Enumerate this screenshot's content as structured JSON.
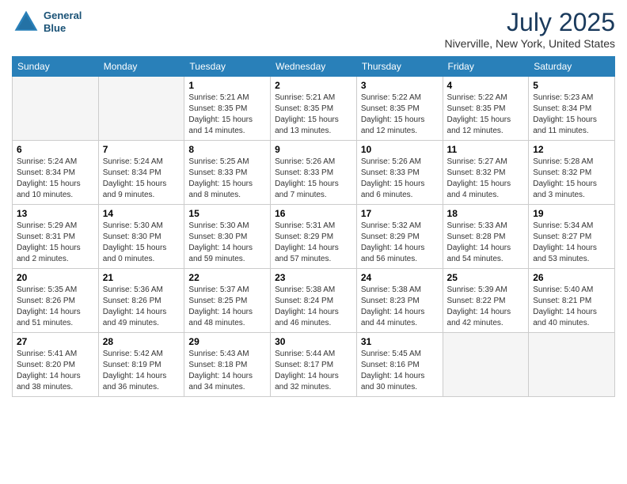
{
  "header": {
    "logo_line1": "General",
    "logo_line2": "Blue",
    "title": "July 2025",
    "location": "Niverville, New York, United States"
  },
  "days_of_week": [
    "Sunday",
    "Monday",
    "Tuesday",
    "Wednesday",
    "Thursday",
    "Friday",
    "Saturday"
  ],
  "weeks": [
    [
      {
        "num": "",
        "info": ""
      },
      {
        "num": "",
        "info": ""
      },
      {
        "num": "1",
        "info": "Sunrise: 5:21 AM\nSunset: 8:35 PM\nDaylight: 15 hours\nand 14 minutes."
      },
      {
        "num": "2",
        "info": "Sunrise: 5:21 AM\nSunset: 8:35 PM\nDaylight: 15 hours\nand 13 minutes."
      },
      {
        "num": "3",
        "info": "Sunrise: 5:22 AM\nSunset: 8:35 PM\nDaylight: 15 hours\nand 12 minutes."
      },
      {
        "num": "4",
        "info": "Sunrise: 5:22 AM\nSunset: 8:35 PM\nDaylight: 15 hours\nand 12 minutes."
      },
      {
        "num": "5",
        "info": "Sunrise: 5:23 AM\nSunset: 8:34 PM\nDaylight: 15 hours\nand 11 minutes."
      }
    ],
    [
      {
        "num": "6",
        "info": "Sunrise: 5:24 AM\nSunset: 8:34 PM\nDaylight: 15 hours\nand 10 minutes."
      },
      {
        "num": "7",
        "info": "Sunrise: 5:24 AM\nSunset: 8:34 PM\nDaylight: 15 hours\nand 9 minutes."
      },
      {
        "num": "8",
        "info": "Sunrise: 5:25 AM\nSunset: 8:33 PM\nDaylight: 15 hours\nand 8 minutes."
      },
      {
        "num": "9",
        "info": "Sunrise: 5:26 AM\nSunset: 8:33 PM\nDaylight: 15 hours\nand 7 minutes."
      },
      {
        "num": "10",
        "info": "Sunrise: 5:26 AM\nSunset: 8:33 PM\nDaylight: 15 hours\nand 6 minutes."
      },
      {
        "num": "11",
        "info": "Sunrise: 5:27 AM\nSunset: 8:32 PM\nDaylight: 15 hours\nand 4 minutes."
      },
      {
        "num": "12",
        "info": "Sunrise: 5:28 AM\nSunset: 8:32 PM\nDaylight: 15 hours\nand 3 minutes."
      }
    ],
    [
      {
        "num": "13",
        "info": "Sunrise: 5:29 AM\nSunset: 8:31 PM\nDaylight: 15 hours\nand 2 minutes."
      },
      {
        "num": "14",
        "info": "Sunrise: 5:30 AM\nSunset: 8:30 PM\nDaylight: 15 hours\nand 0 minutes."
      },
      {
        "num": "15",
        "info": "Sunrise: 5:30 AM\nSunset: 8:30 PM\nDaylight: 14 hours\nand 59 minutes."
      },
      {
        "num": "16",
        "info": "Sunrise: 5:31 AM\nSunset: 8:29 PM\nDaylight: 14 hours\nand 57 minutes."
      },
      {
        "num": "17",
        "info": "Sunrise: 5:32 AM\nSunset: 8:29 PM\nDaylight: 14 hours\nand 56 minutes."
      },
      {
        "num": "18",
        "info": "Sunrise: 5:33 AM\nSunset: 8:28 PM\nDaylight: 14 hours\nand 54 minutes."
      },
      {
        "num": "19",
        "info": "Sunrise: 5:34 AM\nSunset: 8:27 PM\nDaylight: 14 hours\nand 53 minutes."
      }
    ],
    [
      {
        "num": "20",
        "info": "Sunrise: 5:35 AM\nSunset: 8:26 PM\nDaylight: 14 hours\nand 51 minutes."
      },
      {
        "num": "21",
        "info": "Sunrise: 5:36 AM\nSunset: 8:26 PM\nDaylight: 14 hours\nand 49 minutes."
      },
      {
        "num": "22",
        "info": "Sunrise: 5:37 AM\nSunset: 8:25 PM\nDaylight: 14 hours\nand 48 minutes."
      },
      {
        "num": "23",
        "info": "Sunrise: 5:38 AM\nSunset: 8:24 PM\nDaylight: 14 hours\nand 46 minutes."
      },
      {
        "num": "24",
        "info": "Sunrise: 5:38 AM\nSunset: 8:23 PM\nDaylight: 14 hours\nand 44 minutes."
      },
      {
        "num": "25",
        "info": "Sunrise: 5:39 AM\nSunset: 8:22 PM\nDaylight: 14 hours\nand 42 minutes."
      },
      {
        "num": "26",
        "info": "Sunrise: 5:40 AM\nSunset: 8:21 PM\nDaylight: 14 hours\nand 40 minutes."
      }
    ],
    [
      {
        "num": "27",
        "info": "Sunrise: 5:41 AM\nSunset: 8:20 PM\nDaylight: 14 hours\nand 38 minutes."
      },
      {
        "num": "28",
        "info": "Sunrise: 5:42 AM\nSunset: 8:19 PM\nDaylight: 14 hours\nand 36 minutes."
      },
      {
        "num": "29",
        "info": "Sunrise: 5:43 AM\nSunset: 8:18 PM\nDaylight: 14 hours\nand 34 minutes."
      },
      {
        "num": "30",
        "info": "Sunrise: 5:44 AM\nSunset: 8:17 PM\nDaylight: 14 hours\nand 32 minutes."
      },
      {
        "num": "31",
        "info": "Sunrise: 5:45 AM\nSunset: 8:16 PM\nDaylight: 14 hours\nand 30 minutes."
      },
      {
        "num": "",
        "info": ""
      },
      {
        "num": "",
        "info": ""
      }
    ]
  ]
}
